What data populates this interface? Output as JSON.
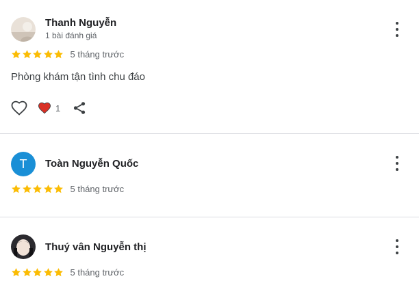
{
  "colors": {
    "star": "#fbbc04",
    "heart": "#d93025",
    "avatar_letter_bg": "#1a8fd6"
  },
  "reviews": [
    {
      "name": "Thanh Nguyễn",
      "meta": "1 bài đánh giá",
      "rating": 5,
      "time": "5 tháng trước",
      "text": "Phòng khám tận tình chu đáo",
      "reaction_count": "1",
      "avatar": "photo-icon"
    },
    {
      "name": "Toàn Nguyễn Quốc",
      "avatar_letter": "T",
      "rating": 5,
      "time": "5 tháng trước"
    },
    {
      "name": "Thuý vân Nguyễn thị",
      "rating": 5,
      "time": "5 tháng trước",
      "avatar": "photo-icon"
    }
  ]
}
